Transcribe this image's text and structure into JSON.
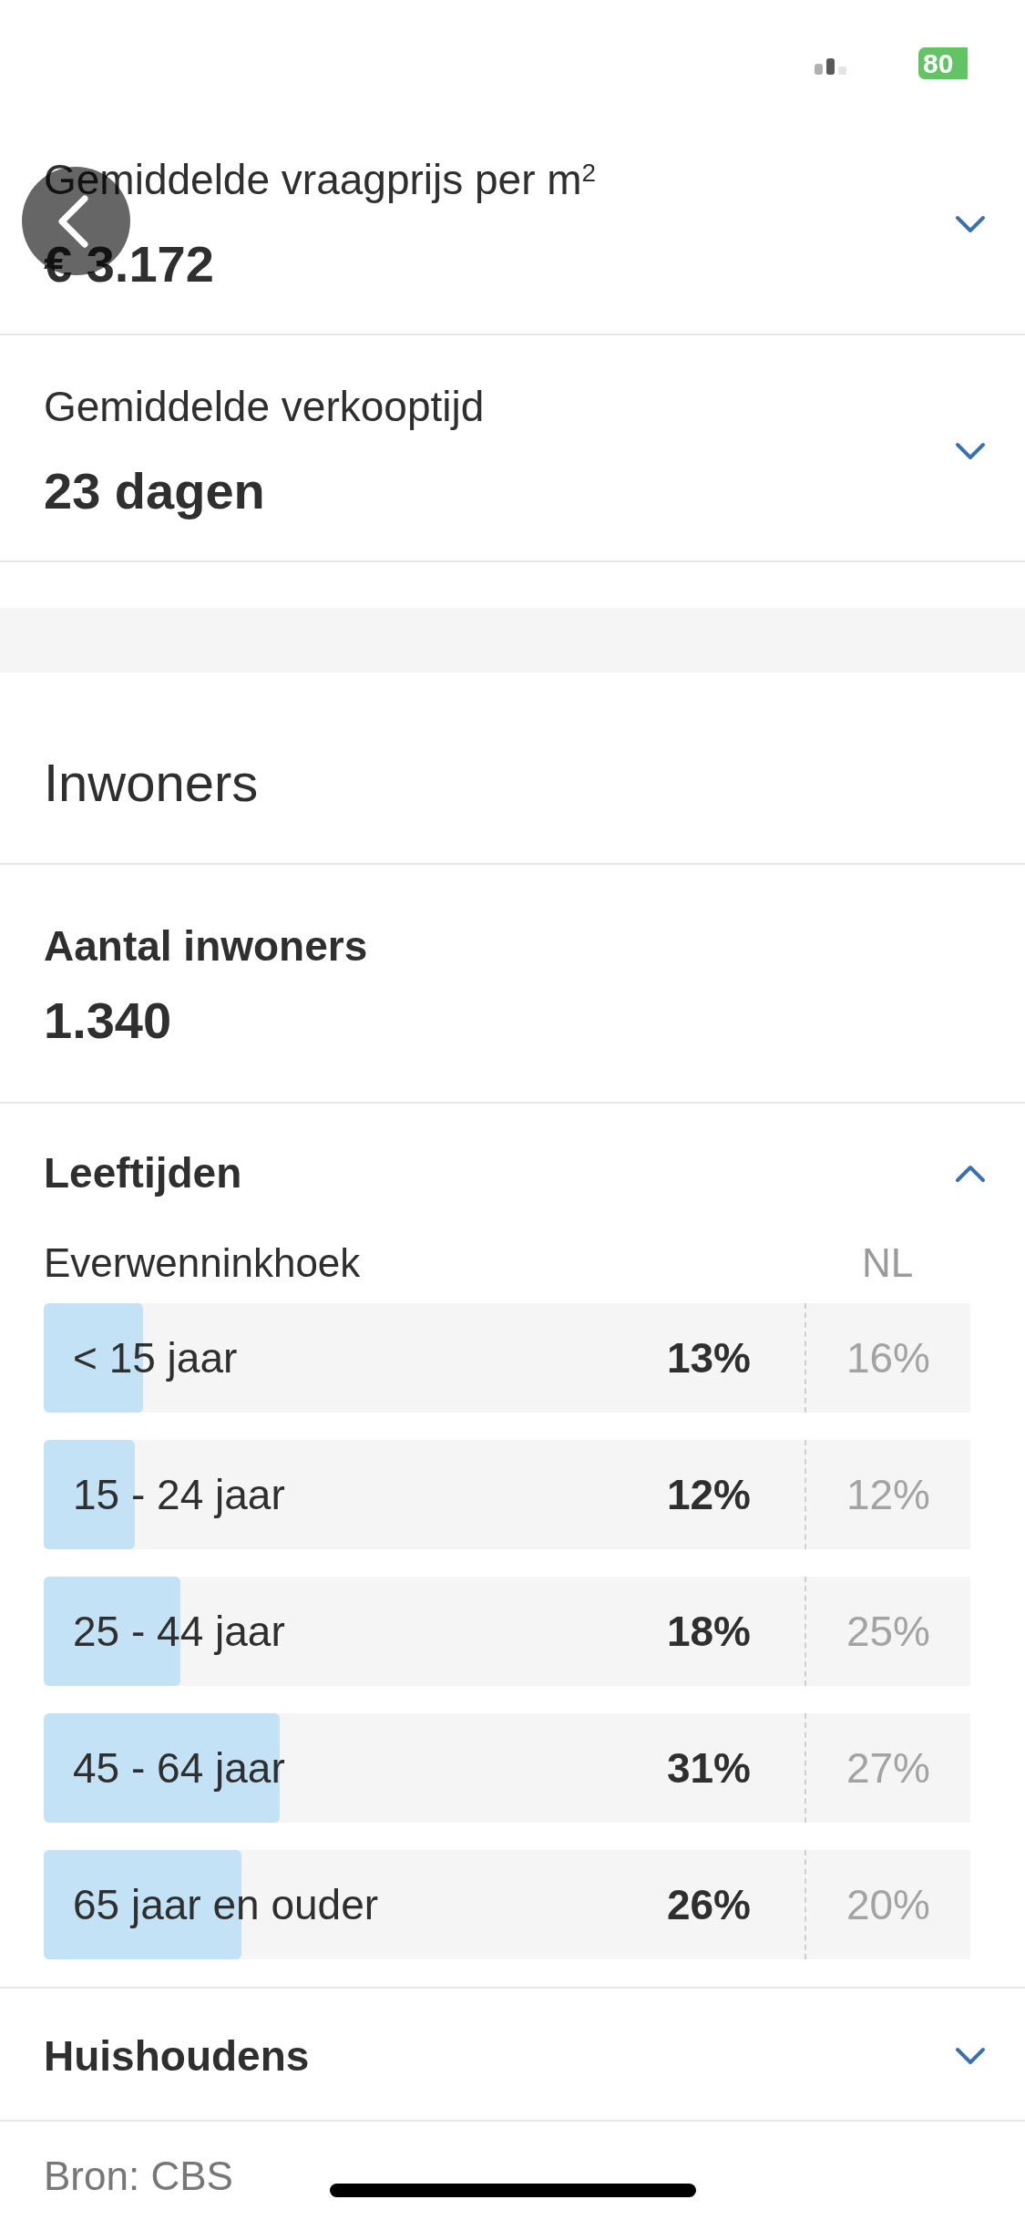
{
  "status_bar": {
    "battery": "80"
  },
  "stats": [
    {
      "label": "Gemiddelde vraagprijs per m$^{2}$",
      "value": "€ 3.172",
      "expanded": false
    },
    {
      "label": "Gemiddelde verkooptijd",
      "value": "23 dagen",
      "expanded": false
    }
  ],
  "residents": {
    "title": "Inwoners",
    "count": {
      "label": "Aantal inwoners",
      "value": "1.340"
    },
    "ages": {
      "title": "Leeftijden",
      "expanded": true,
      "area_heading": "Everwenninkhoek",
      "comparison_heading": "NL",
      "rows": [
        {
          "label": "< 15 jaar",
          "value": "13%",
          "nl_value": "16%",
          "level": 0.13
        },
        {
          "label": "15 - 24 jaar",
          "value": "12%",
          "nl_value": "12%",
          "level": 0.12
        },
        {
          "label": "25 - 44 jaar",
          "value": "18%",
          "nl_value": "25%",
          "level": 0.18
        },
        {
          "label": "45 - 64 jaar",
          "value": "31%",
          "nl_value": "27%",
          "level": 0.31
        },
        {
          "label": "65 jaar en ouder",
          "value": "26%",
          "nl_value": "20%",
          "level": 0.26
        }
      ]
    },
    "households": {
      "title": "Huishoudens",
      "expanded": false
    }
  },
  "footer": {
    "source": "Bron: CBS"
  }
}
